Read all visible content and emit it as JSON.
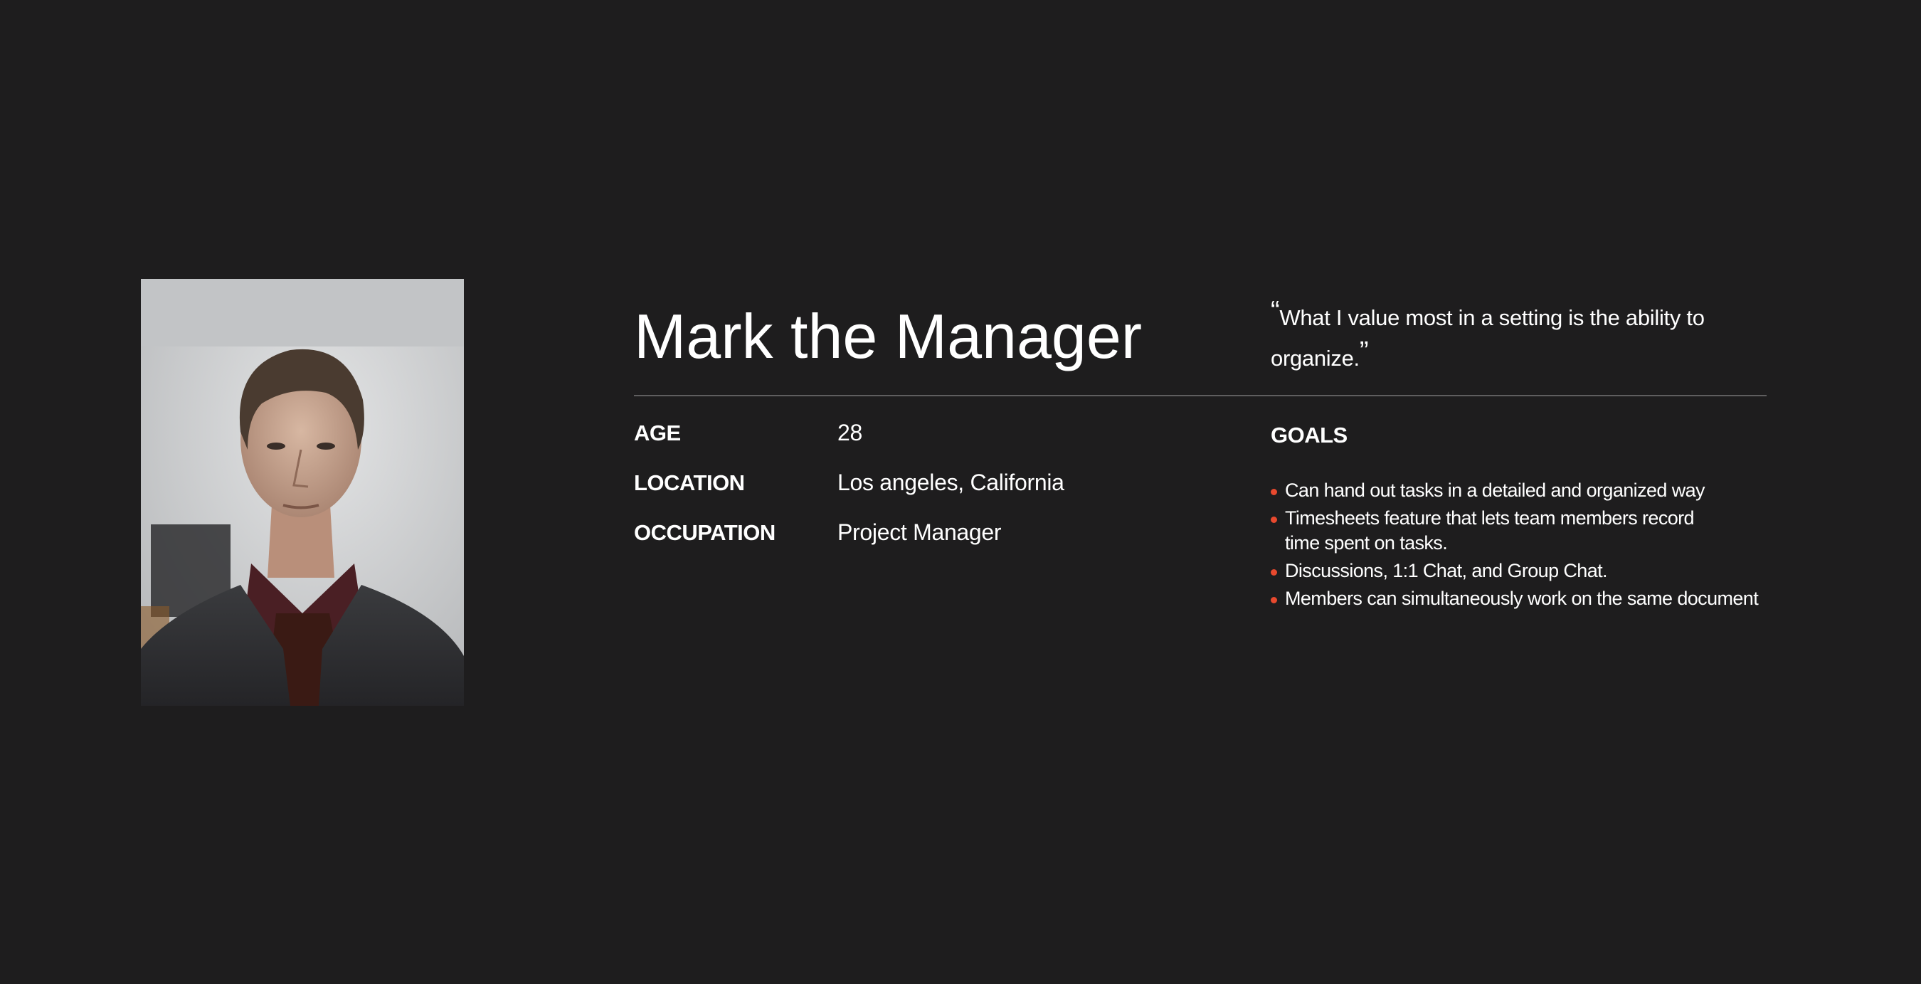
{
  "persona": {
    "name": "Mark the Manager",
    "quote_open": "“",
    "quote_text": "What I value most in a setting is the ability to organize.",
    "quote_close": "”"
  },
  "details": [
    {
      "label": "AGE",
      "value": "28"
    },
    {
      "label": "LOCATION",
      "value": "Los angeles, California"
    },
    {
      "label": "OCCUPATION",
      "value": "Project Manager"
    }
  ],
  "goals": {
    "heading": "GOALS",
    "items": [
      "Can hand out tasks in a detailed and organized way",
      "Timesheets feature that lets team members record time spent on tasks.",
      "Discussions, 1:1 Chat, and Group Chat.",
      "Members can simultaneously work on the same document"
    ]
  },
  "colors": {
    "background": "#1e1d1e",
    "text": "#ffffff",
    "accent_bullet": "#e8492e",
    "divider": "#5f5e5f"
  }
}
